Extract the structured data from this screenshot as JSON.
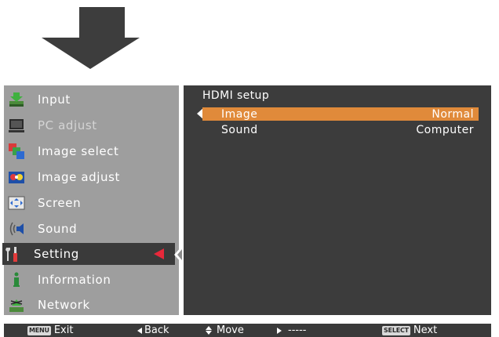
{
  "sidebar": {
    "items": [
      {
        "label": "Input",
        "icon": "input-icon"
      },
      {
        "label": "PC adjust",
        "icon": "pc-adjust-icon"
      },
      {
        "label": "Image select",
        "icon": "image-select-icon"
      },
      {
        "label": "Image adjust",
        "icon": "image-adjust-icon"
      },
      {
        "label": "Screen",
        "icon": "screen-icon"
      },
      {
        "label": "Sound",
        "icon": "sound-icon"
      },
      {
        "label": "Setting",
        "icon": "setting-icon"
      },
      {
        "label": "Information",
        "icon": "information-icon"
      },
      {
        "label": "Network",
        "icon": "network-icon"
      }
    ],
    "selected": "Setting"
  },
  "panel": {
    "title": "HDMI setup",
    "rows": [
      {
        "label": "Image",
        "value": "Normal"
      },
      {
        "label": "Sound",
        "value": "Computer"
      }
    ]
  },
  "footer": {
    "exit_key": "MENU",
    "exit_label": "Exit",
    "back_label": "Back",
    "move_label": "Move",
    "right_label": "-----",
    "next_key": "SELECT",
    "next_label": "Next"
  },
  "colors": {
    "highlight": "#e08a3a",
    "selector": "#e8283a",
    "panel_bg": "#3c3c3c",
    "sidebar_bg": "#9e9e9e"
  }
}
